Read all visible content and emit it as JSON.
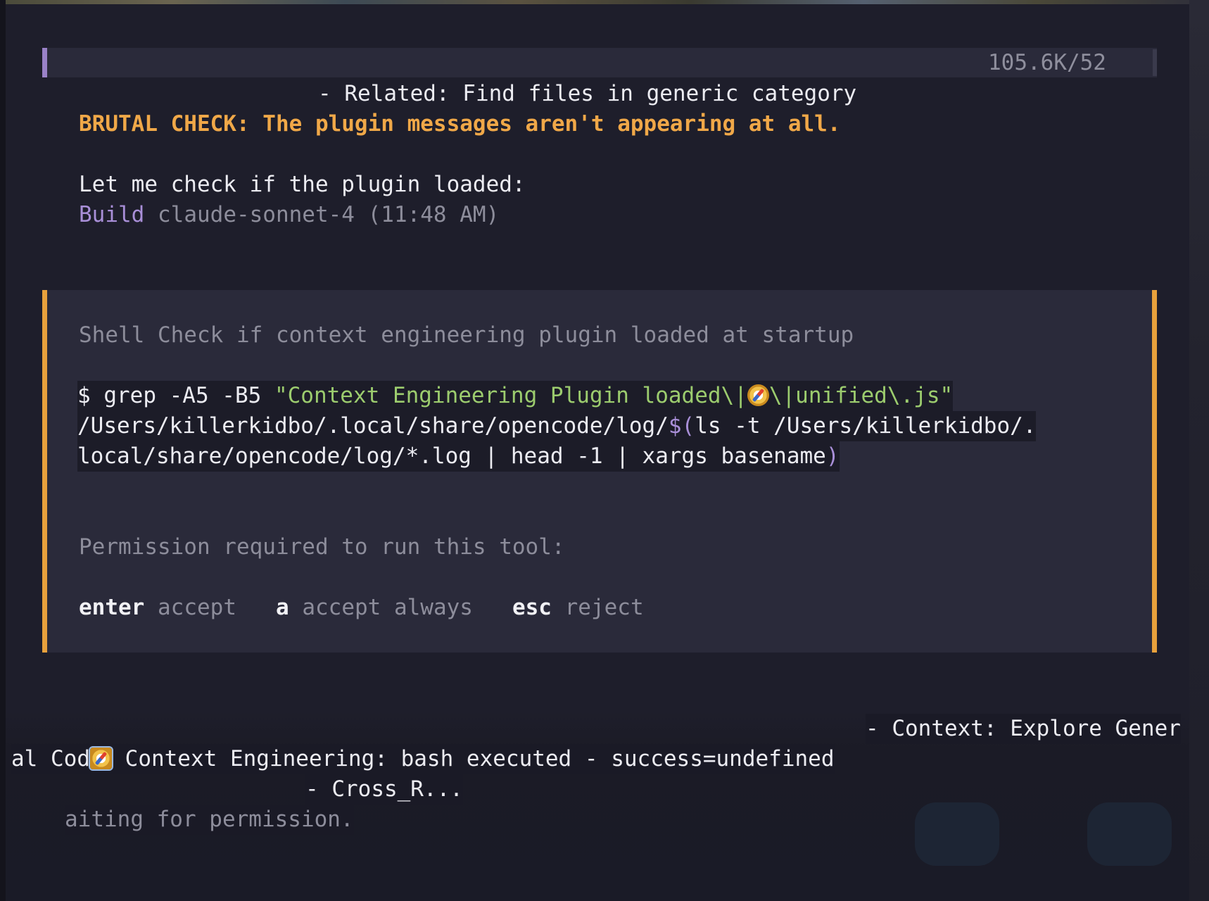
{
  "status_bar": {
    "token_count": "105.6K/52"
  },
  "log_line_related": "- Related: Find files in generic category",
  "brutal_check": "BRUTAL CHECK: The plugin messages aren't appearing at all.",
  "let_me_check": "Let me check if the plugin loaded:",
  "build_line": {
    "mode": "Build",
    "model_time": "claude-sonnet-4 (11:48 AM)"
  },
  "tool_panel": {
    "title": "Shell Check if context engineering plugin loaded at startup",
    "command": {
      "prompt": "$ grep -A5 -B5 ",
      "string_part1": "\"Context Engineering Plugin loaded\\|",
      "string_part2": "\\|unified\\.js\"",
      "line2_a": "/Users/killerkidbo/.local/share/opencode/log/",
      "line2_subshell_open": "$(",
      "line2_b": "ls -t /Users/killerkidbo/.",
      "line3_a": "local/share/opencode/log/*.log | head -1 | xargs basename",
      "line3_close": ")"
    },
    "permission_text": "Permission required to run this tool:",
    "actions": [
      {
        "key": "enter",
        "label": "accept"
      },
      {
        "key": "a",
        "label": "accept always"
      },
      {
        "key": "esc",
        "label": "reject"
      }
    ]
  },
  "overlay": {
    "context_line": "- Context: Explore Gener",
    "al_cod": "al Cod",
    "engineering_line": "Context Engineering: bash executed - success=undefined",
    "cross_line": "- Cross_R...",
    "waiting_line": "aiting for permission."
  },
  "icons": {
    "compass": "compass-icon"
  },
  "colors": {
    "accent_orange": "#e8a13c",
    "accent_purple": "#9a82c8",
    "string_green": "#9ccc6e",
    "background": "#1e1e2b",
    "panel": "#2a2a3a"
  }
}
